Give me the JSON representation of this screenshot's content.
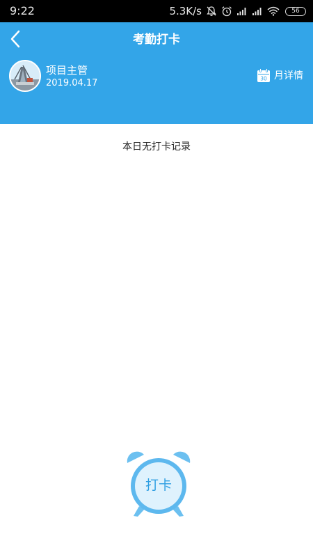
{
  "status_bar": {
    "time": "9:22",
    "network_speed": "5.3K/s",
    "battery": "56",
    "icons": [
      "mute-notification-icon",
      "alarm-icon",
      "signal-icon",
      "signal-icon",
      "wifi-icon",
      "battery-icon"
    ]
  },
  "header": {
    "title": "考勤打卡",
    "back_icon": "chevron-left-icon",
    "background_color": "#33a5e8"
  },
  "user": {
    "name": "项目主管",
    "date": "2019.04.17"
  },
  "month_detail": {
    "label": "月详情",
    "calendar_day": "30",
    "icon": "calendar-icon"
  },
  "content": {
    "empty_message": "本日无打卡记录"
  },
  "punch_button": {
    "label": "打卡",
    "icon": "alarm-clock-icon",
    "accent_color": "#6cc0f0"
  }
}
